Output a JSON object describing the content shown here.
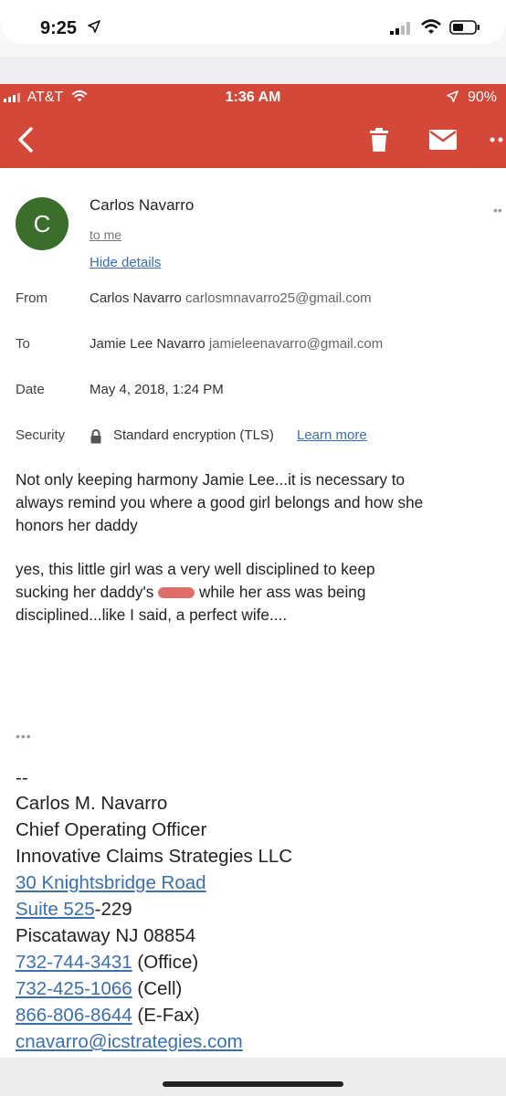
{
  "outer_status": {
    "time": "9:25"
  },
  "inner_status": {
    "carrier": "AT&T",
    "time": "1:36 AM",
    "battery": "90%"
  },
  "sender": {
    "initial": "C",
    "name": "Carlos Navarro",
    "to_line": "to me",
    "hide_details": "Hide details"
  },
  "details": {
    "from_label": "From",
    "from_name": "Carlos Navarro",
    "from_email": "carlosmnavarro25@gmail.com",
    "to_label": "To",
    "to_name": "Jamie Lee Navarro",
    "to_email": "jamieleenavarro@gmail.com",
    "date_label": "Date",
    "date_value": "May 4, 2018, 1:24 PM",
    "security_label": "Security",
    "security_value": "Standard encryption (TLS)",
    "learn_more": "Learn more"
  },
  "body": {
    "para1_line1": "Not only keeping harmony Jamie Lee...it is necessary to",
    "para1_line2": "always remind you where a good girl belongs and how she",
    "para1_line3": "honors her daddy",
    "para2_line1": "yes, this little girl was a very well disciplined to keep",
    "para2_line2_before": "sucking her daddy's",
    "para2_line2_after": "while her ass was being",
    "para2_line3": "disciplined...like I said, a perfect wife....",
    "quoted_dots": "•••"
  },
  "signature": {
    "separator": "--",
    "name": "Carlos M. Navarro",
    "title": "Chief Operating Officer",
    "company": "Innovative Claims Strategies LLC",
    "address1": "30 Knightsbridge Road",
    "suite_link": "Suite 525",
    "suite_rest": "-229",
    "city": "Piscataway NJ 08854",
    "office_phone": "732-744-3431",
    "office_label": "(Office)",
    "cell_phone": "732-425-1066",
    "cell_label": "(Cell)",
    "fax_phone": "866-806-8644",
    "fax_label": "(E-Fax)",
    "email": "cnavarro@icstrategies.com"
  },
  "colors": {
    "toolbar": "#d34838",
    "avatar": "#3a6e2a",
    "link": "#3a6fb0"
  },
  "icons": [
    "location-arrow-icon",
    "signal-icon",
    "wifi-icon",
    "battery-icon",
    "back-arrow-icon",
    "trash-icon",
    "mail-icon",
    "more-icon",
    "lock-icon"
  ]
}
